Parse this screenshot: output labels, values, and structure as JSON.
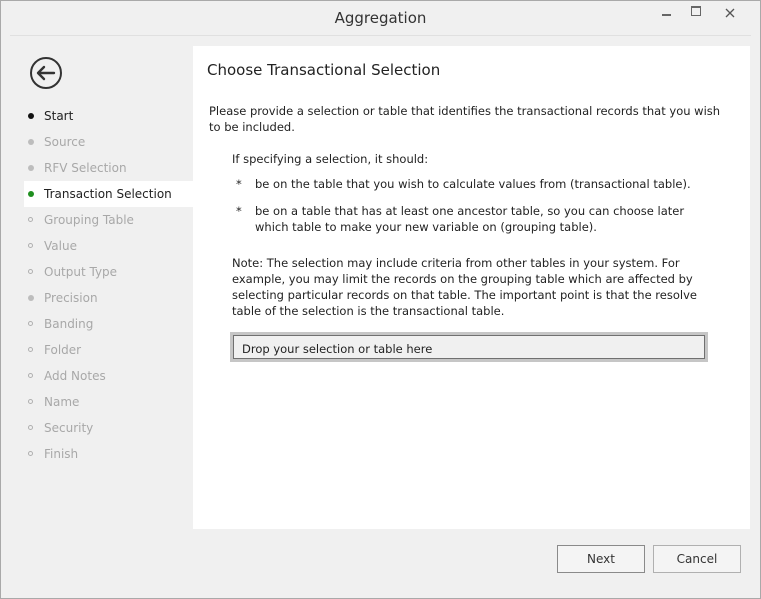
{
  "window": {
    "title": "Aggregation"
  },
  "sidebar": {
    "steps": [
      {
        "label": "Start",
        "state": "done"
      },
      {
        "label": "Source",
        "state": "gray"
      },
      {
        "label": "RFV Selection",
        "state": "gray"
      },
      {
        "label": "Transaction Selection",
        "state": "active"
      },
      {
        "label": "Grouping Table",
        "state": "pending"
      },
      {
        "label": "Value",
        "state": "pending"
      },
      {
        "label": "Output Type",
        "state": "pending"
      },
      {
        "label": "Precision",
        "state": "gray"
      },
      {
        "label": "Banding",
        "state": "pending"
      },
      {
        "label": "Folder",
        "state": "pending"
      },
      {
        "label": "Add Notes",
        "state": "pending"
      },
      {
        "label": "Name",
        "state": "pending"
      },
      {
        "label": "Security",
        "state": "pending"
      },
      {
        "label": "Finish",
        "state": "pending"
      }
    ]
  },
  "content": {
    "heading": "Choose Transactional Selection",
    "intro": "Please provide a selection or table that identifies the transactional records that you wish to be included.",
    "spec_title": "If specifying a selection, it should:",
    "bullet_mark": "*",
    "bullets": [
      "be on the table that you wish to calculate values from (transactional table).",
      "be on a table that has at least one ancestor table, so you can choose later which table to make your new variable on (grouping table)."
    ],
    "note": "Note: The selection may include criteria from other tables in your system. For example, you may limit the records on the grouping table which are affected by selecting particular records on that table. The important point is that the resolve table of the selection is the transactional table.",
    "drop_zone": "Drop your selection or table here"
  },
  "footer": {
    "next_label": "Next",
    "cancel_label": "Cancel"
  },
  "colors": {
    "active_dot": "#1f8f1f",
    "content_bg": "#ffffff",
    "window_bg": "#f0f0f0"
  }
}
